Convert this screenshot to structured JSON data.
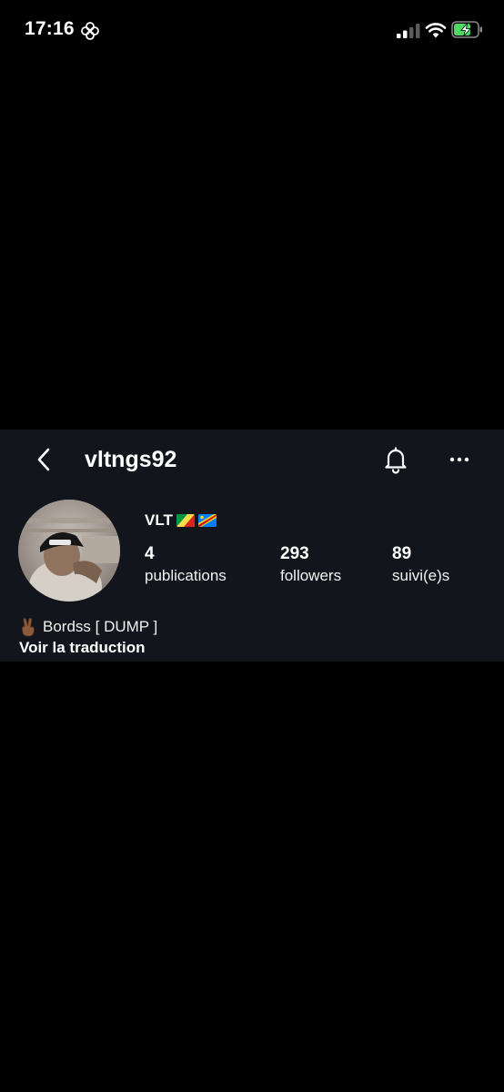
{
  "status_bar": {
    "time": "17:16",
    "icons": [
      "flower-icon",
      "signal-icon",
      "wifi-icon",
      "battery-charging-icon"
    ]
  },
  "header": {
    "username": "vltngs92",
    "icons": [
      "back-chevron-icon",
      "bell-icon",
      "more-dots-icon"
    ]
  },
  "profile": {
    "display_name": "VLT",
    "flags": [
      "republic-of-congo-flag",
      "dr-congo-flag"
    ],
    "stats": {
      "posts": {
        "value": "4",
        "label": "publications"
      },
      "followers": {
        "value": "293",
        "label": "followers"
      },
      "following": {
        "value": "89",
        "label": "suivi(e)s"
      }
    },
    "bio": "Bordss [ DUMP ]",
    "bio_icon": "victory-hand-icon",
    "translate_label": "Voir la traduction"
  },
  "colors": {
    "background": "#000000",
    "card_background": "#12151b",
    "text": "#ffffff",
    "battery_green": "#4cd964"
  }
}
